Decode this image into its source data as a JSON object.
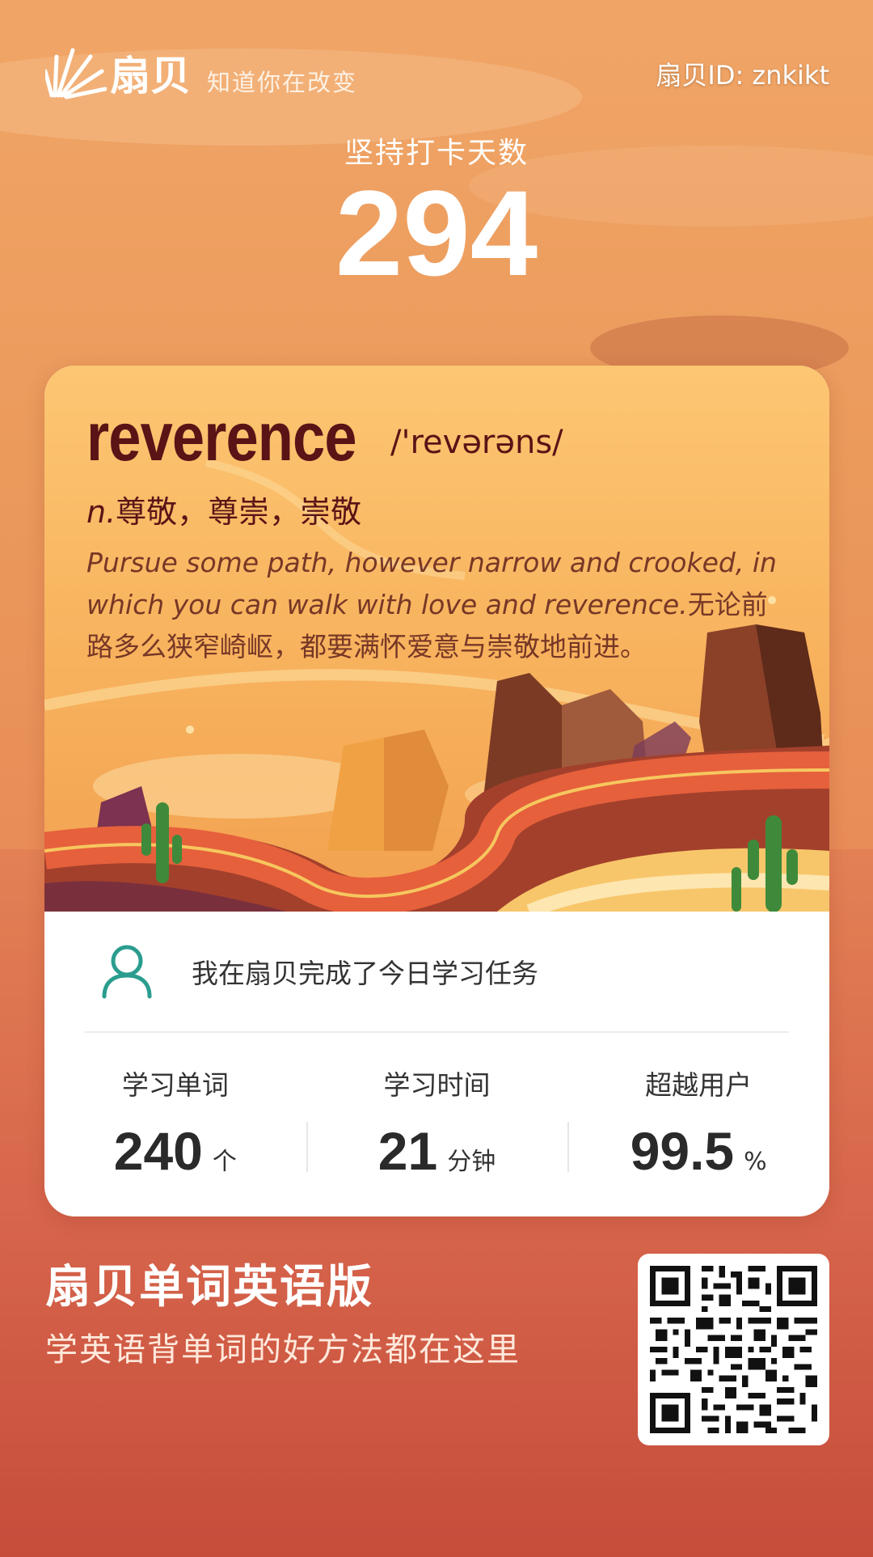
{
  "brand": {
    "name": "扇贝",
    "slogan": "知道你在改变",
    "logo_icon": "shell-fan-icon"
  },
  "user": {
    "id_text": "扇贝ID: znkikt"
  },
  "streak": {
    "label": "坚持打卡天数",
    "value": "294"
  },
  "word_card": {
    "word": "reverence",
    "phonetic": "/'revərəns/",
    "pos": "n.",
    "definition": "尊敬，尊崇，崇敬",
    "example_en": "Pursue some path, however narrow and crooked, in which you can walk with love and reverence.",
    "example_cn": "无论前路多么狭窄崎岖，都要满怀爱意与崇敬地前进。"
  },
  "task": {
    "icon": "user-icon",
    "text": "我在扇贝完成了今日学习任务"
  },
  "stats": [
    {
      "label": "学习单词",
      "value": "240",
      "unit": "个"
    },
    {
      "label": "学习时间",
      "value": "21",
      "unit": "分钟"
    },
    {
      "label": "超越用户",
      "value": "99.5",
      "unit": "%"
    }
  ],
  "footer": {
    "app_name": "扇贝单词英语版",
    "tagline": "学英语背单词的好方法都在这里",
    "qr_icon": "qr-code-icon"
  },
  "colors": {
    "word_text": "#5a1416",
    "accent_teal": "#2a9d8f",
    "background_top": "#f0a566",
    "background_bottom": "#c14735"
  }
}
